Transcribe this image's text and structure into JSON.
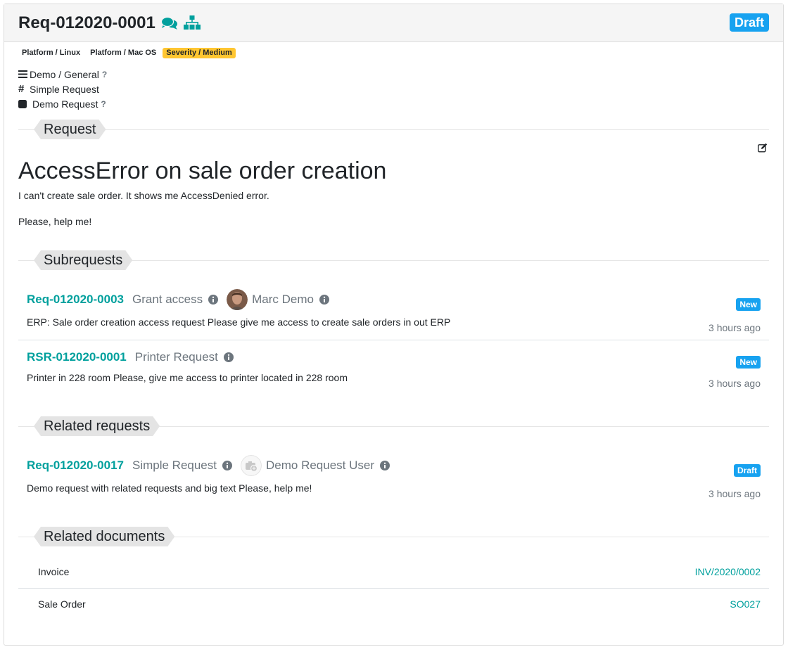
{
  "header": {
    "title": "Req-012020-0001",
    "state": "Draft",
    "icons": [
      "comments-icon",
      "sitemap-icon"
    ]
  },
  "tags": [
    {
      "label": "Platform / Linux",
      "color": "none"
    },
    {
      "label": "Platform / Mac OS",
      "color": "none"
    },
    {
      "label": "Severity / Medium",
      "color": "#ffc631"
    }
  ],
  "meta": {
    "category": "Demo / General",
    "category_help": "?",
    "type": "Simple Request",
    "kind": "Demo Request",
    "kind_help": "?"
  },
  "sections": {
    "request": "Request",
    "subrequests": "Subrequests",
    "related_requests": "Related requests",
    "related_documents": "Related documents"
  },
  "request": {
    "title": "AccessError on sale order creation",
    "paragraphs": [
      "I can't create sale order. It shows me AccessDenied error.",
      "Please, help me!"
    ]
  },
  "subrequests": [
    {
      "ref": "Req-012020-0003",
      "type": "Grant access",
      "user": "Marc Demo",
      "description": "ERP: Sale order creation access request Please give me access to create sale orders in out ERP",
      "state": "New",
      "date": "3 hours ago"
    },
    {
      "ref": "RSR-012020-0001",
      "type": "Printer Request",
      "user": "",
      "description": "Printer in 228 room Please, give me access to printer located in 228 room",
      "state": "New",
      "date": "3 hours ago"
    }
  ],
  "related_requests": [
    {
      "ref": "Req-012020-0017",
      "type": "Simple Request",
      "user": "Demo Request User",
      "description": "Demo request with related requests and big text Please, help me!",
      "state": "Draft",
      "date": "3 hours ago"
    }
  ],
  "related_documents": [
    {
      "name": "Invoice",
      "ref": "INV/2020/0002"
    },
    {
      "name": "Sale Order",
      "ref": "SO027"
    }
  ],
  "colors": {
    "accent": "#00a09d",
    "badge": "#17a2f0",
    "warning": "#ffc631",
    "muted": "#6c757d"
  }
}
